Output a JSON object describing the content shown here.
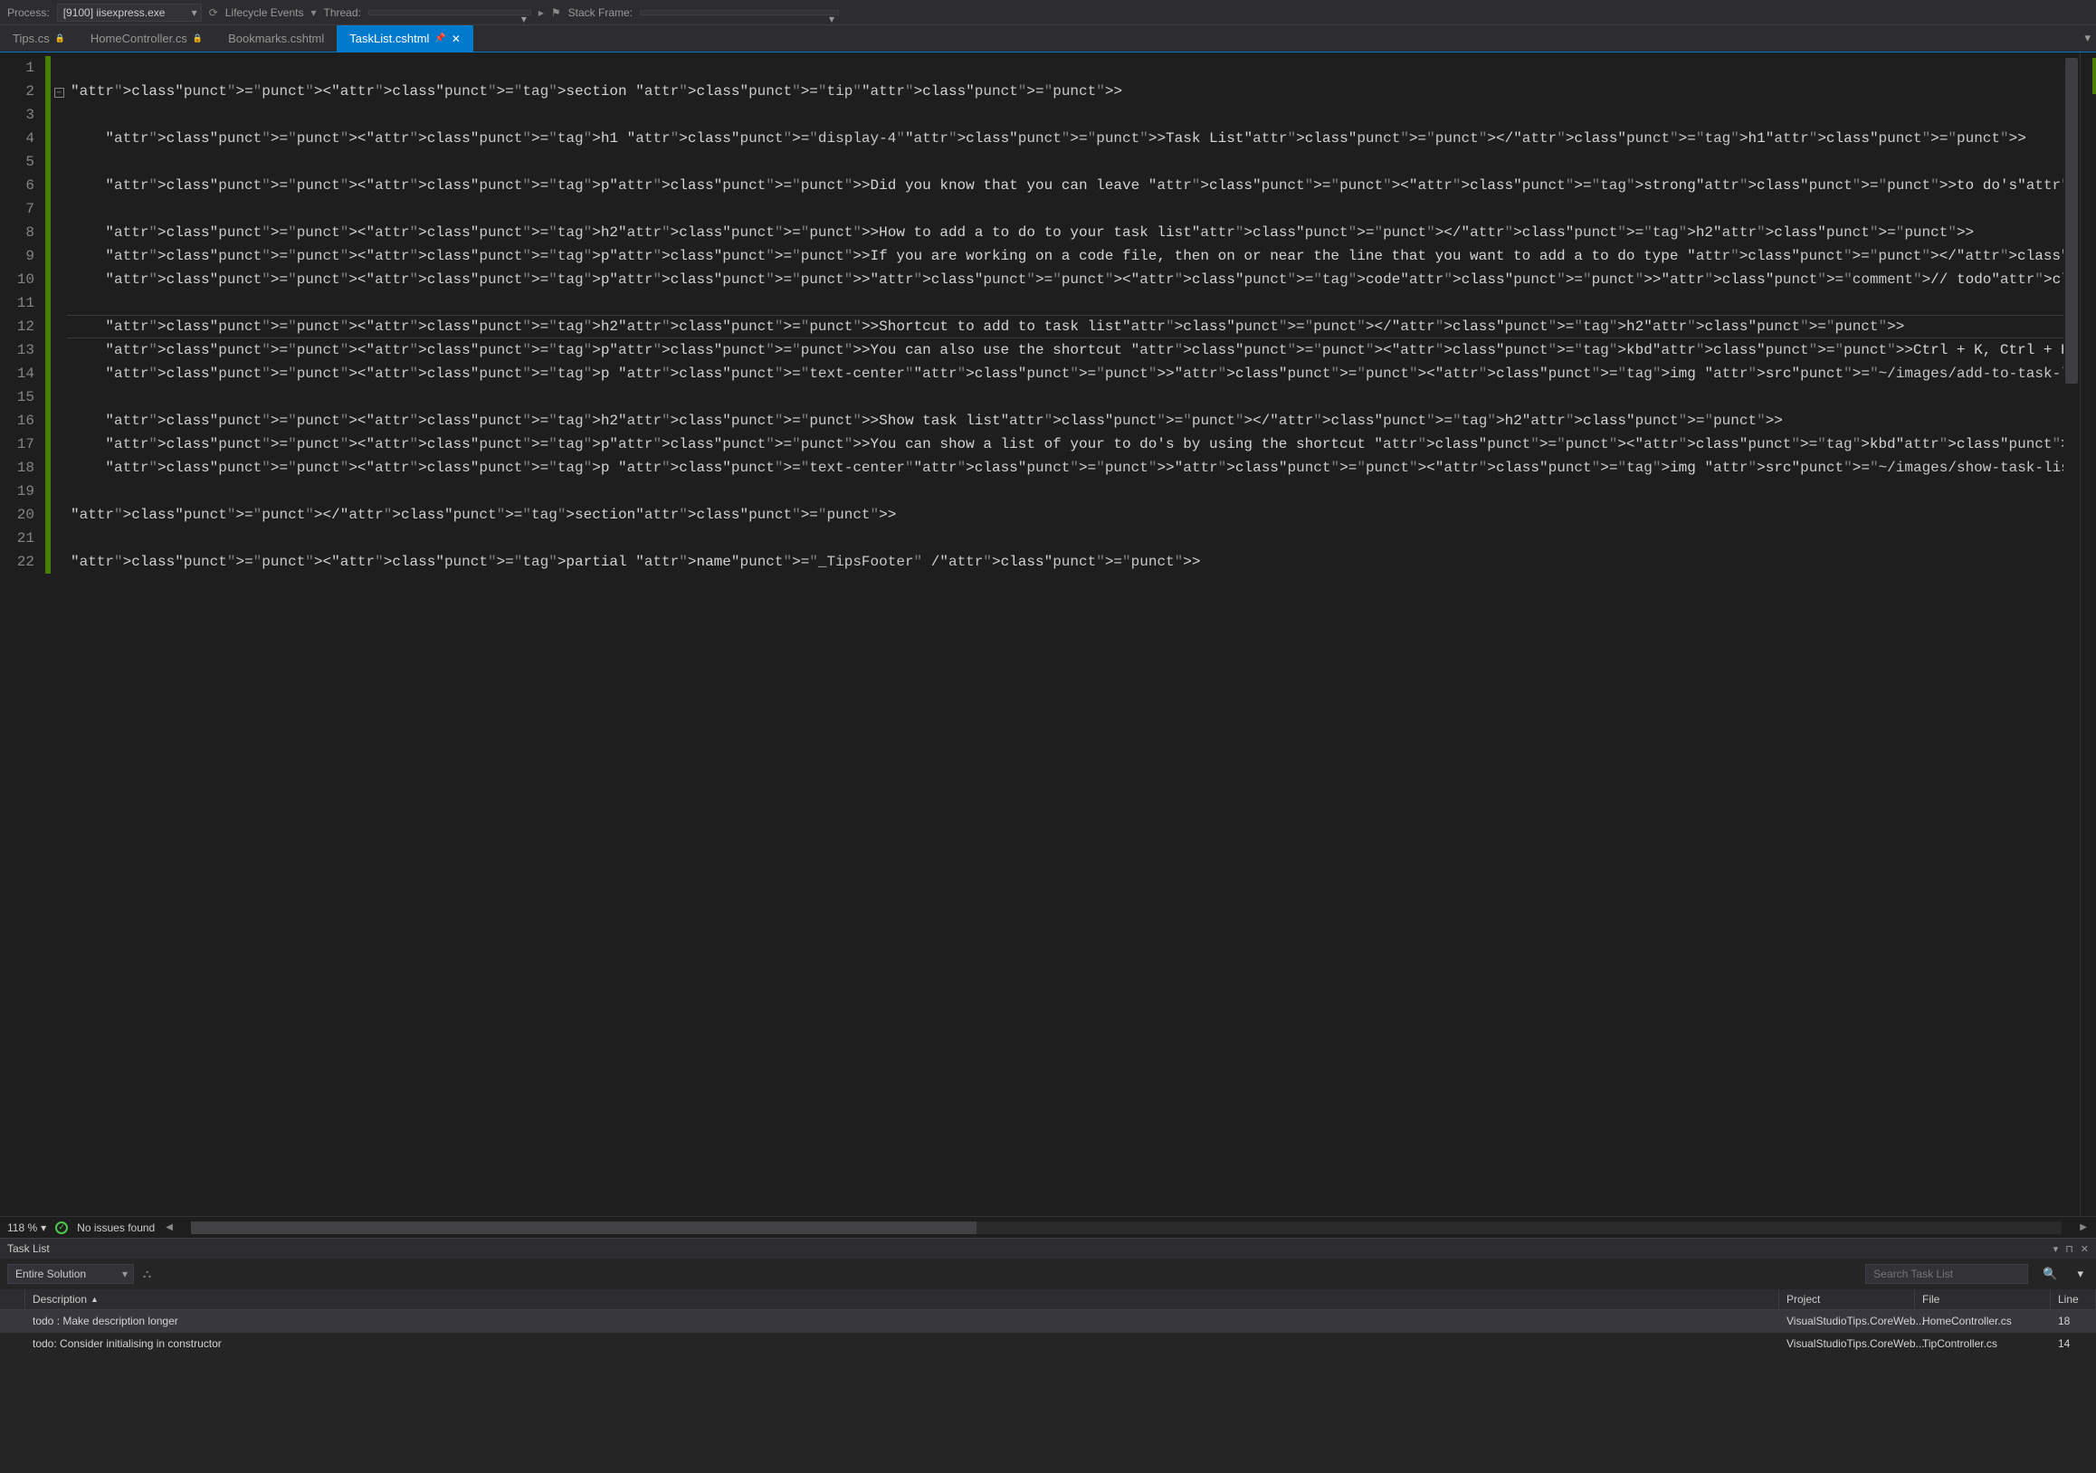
{
  "toolbar": {
    "process_label": "Process:",
    "process_value": "[9100] iisexpress.exe",
    "lifecycle_label": "Lifecycle Events",
    "thread_label": "Thread:",
    "stackframe_label": "Stack Frame:"
  },
  "tabs": [
    {
      "label": "Tips.cs",
      "locked": true
    },
    {
      "label": "HomeController.cs",
      "locked": true
    },
    {
      "label": "Bookmarks.cshtml"
    },
    {
      "label": "TaskList.cshtml",
      "active": true,
      "pinned": true,
      "closable": true
    }
  ],
  "editor": {
    "lines": [
      "",
      "<section class=\"tip\">",
      "",
      "    <h1 class=\"display-4\">Task List</h1>",
      "",
      "    <p>Did you know that you can leave <strong>to do's</strong> to a task list in your code to remind you to come back t",
      "",
      "    <h2>How to add a to do to your task list</h2>",
      "    <p>If you are working on a code file, then on or near the line that you want to add a to do type </p>",
      "    <p><code>// todo</code></p>",
      "",
      "    <h2>Shortcut to add to task list</h2>",
      "    <p>You can also use the shortcut <kbd>Ctrl + K, Ctrl + H</kbd> and it will add a reference to the line to the task ",
      "    <p class=\"text-center\"><img src=\"~/images/add-to-task-list.gif\" alt=\"Add to task list\" title=\"Add to task list\" /><",
      "",
      "    <h2>Show task list</h2>",
      "    <p>You can show a list of your to do's by using the shortcut <kbd>Ctrl + \\ , Ctrl + T</kbd></p>",
      "    <p class=\"text-center\"><img src=\"~/images/show-task-list.gif\" alt=\"Show task list\" title=\"Show task list\" /></p>",
      "",
      "</section>",
      "",
      "<partial name=\"_TipsFooter\" />"
    ],
    "highlighted_line": 12,
    "zoom": "118 %",
    "issues": "No issues found"
  },
  "tasklist": {
    "title": "Task List",
    "scope": "Entire Solution",
    "search_placeholder": "Search Task List",
    "columns": {
      "description": "Description",
      "project": "Project",
      "file": "File",
      "line": "Line"
    },
    "rows": [
      {
        "description": "todo : Make description longer",
        "project": "VisualStudioTips.CoreWeb...",
        "file": "HomeController.cs",
        "line": "18",
        "selected": true
      },
      {
        "description": "todo: Consider initialising in constructor",
        "project": "VisualStudioTips.CoreWeb...",
        "file": "TipController.cs",
        "line": "14"
      }
    ]
  }
}
